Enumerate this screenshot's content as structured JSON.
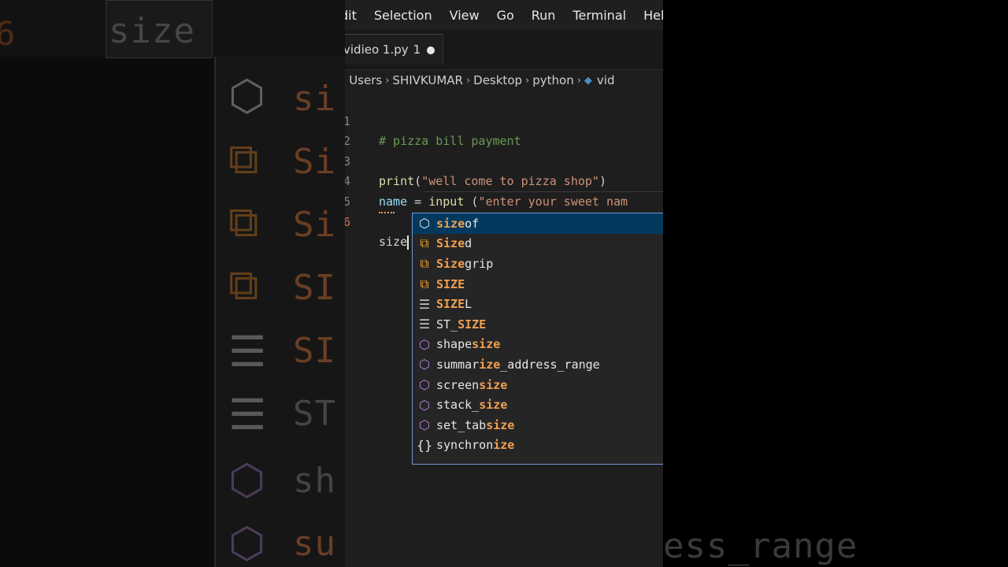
{
  "menubar": {
    "items": [
      "dit",
      "Selection",
      "View",
      "Go",
      "Run",
      "Terminal",
      "Help"
    ]
  },
  "tab": {
    "label": "vidieo 1.py",
    "problem_count": "1"
  },
  "breadcrumb": [
    "Users",
    "SHIVKUMAR",
    "Desktop",
    "python",
    "vid"
  ],
  "code": {
    "lines": [
      {
        "num": "1",
        "text": "# pizza bill payment"
      },
      {
        "num": "2",
        "text": ""
      },
      {
        "num": "3",
        "fn": "print",
        "open": "(",
        "str": "\"well come to pizza shop\"",
        "close": ")"
      },
      {
        "num": "4",
        "var": "name",
        "rest": " = ",
        "fn": "input",
        "open": " (",
        "str": "\"enter your sweet nam"
      },
      {
        "num": "5",
        "text": ""
      },
      {
        "num": "6",
        "text": "size"
      }
    ]
  },
  "suggestions": [
    {
      "icon": "method-icon",
      "glyph": "⬡",
      "kind": "module",
      "parts": [
        {
          "t": "size",
          "m": true
        },
        {
          "t": "of",
          "m": false
        }
      ]
    },
    {
      "icon": "class-icon",
      "glyph": "⧉",
      "kind": "class",
      "parts": [
        {
          "t": "Size",
          "m": true
        },
        {
          "t": "d",
          "m": false
        }
      ]
    },
    {
      "icon": "class-icon",
      "glyph": "⧉",
      "kind": "class",
      "parts": [
        {
          "t": "Size",
          "m": true
        },
        {
          "t": "grip",
          "m": false
        }
      ]
    },
    {
      "icon": "class-icon",
      "glyph": "⧉",
      "kind": "class",
      "parts": [
        {
          "t": "SIZE",
          "m": true
        }
      ]
    },
    {
      "icon": "constant-icon",
      "glyph": "☰",
      "kind": "const",
      "parts": [
        {
          "t": "SIZE",
          "m": true
        },
        {
          "t": "L",
          "m": false
        }
      ]
    },
    {
      "icon": "constant-icon",
      "glyph": "☰",
      "kind": "const",
      "parts": [
        {
          "t": "ST_",
          "m": false
        },
        {
          "t": "SIZE",
          "m": true
        }
      ]
    },
    {
      "icon": "method-icon",
      "glyph": "⬡",
      "kind": "method",
      "parts": [
        {
          "t": "shape",
          "m": false
        },
        {
          "t": "size",
          "m": true
        }
      ]
    },
    {
      "icon": "method-icon",
      "glyph": "⬡",
      "kind": "method",
      "parts": [
        {
          "t": "summar",
          "m": false
        },
        {
          "t": "ize",
          "m": true
        },
        {
          "t": "_address_range",
          "m": false
        }
      ]
    },
    {
      "icon": "method-icon",
      "glyph": "⬡",
      "kind": "method",
      "parts": [
        {
          "t": "screen",
          "m": false
        },
        {
          "t": "size",
          "m": true
        }
      ]
    },
    {
      "icon": "method-icon",
      "glyph": "⬡",
      "kind": "method",
      "parts": [
        {
          "t": "stack_",
          "m": false
        },
        {
          "t": "size",
          "m": true
        }
      ]
    },
    {
      "icon": "method-icon",
      "glyph": "⬡",
      "kind": "method",
      "parts": [
        {
          "t": "set_tab",
          "m": false
        },
        {
          "t": "size",
          "m": true
        }
      ]
    },
    {
      "icon": "namespace-icon",
      "glyph": "{}",
      "kind": "module",
      "parts": [
        {
          "t": "synchron",
          "m": false
        },
        {
          "t": "ize",
          "m": true
        }
      ]
    }
  ],
  "background": {
    "left_words": [
      "size",
      "si",
      "Si",
      "Si",
      "SI",
      "SI",
      "ST",
      "sh",
      "su"
    ],
    "left_number": "6",
    "right_text": "ess_range"
  }
}
